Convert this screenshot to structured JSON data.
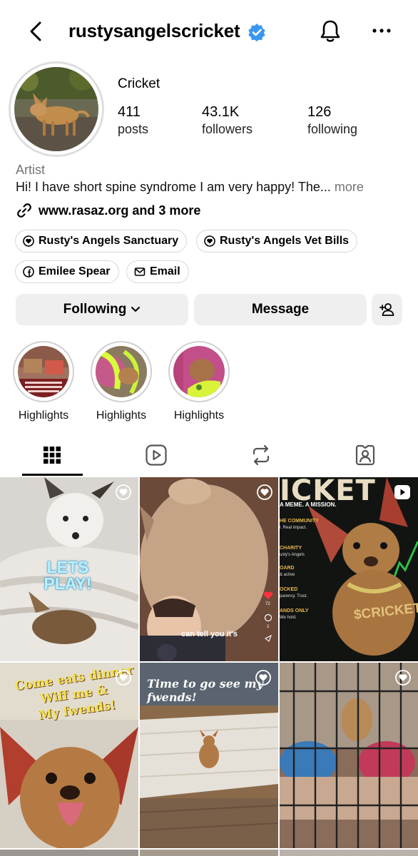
{
  "header": {
    "username": "rustysangelscricket",
    "icons": {
      "back": "chevron-left-icon",
      "verified": "verified-badge-icon",
      "bell": "bell-icon",
      "more": "more-horizontal-icon"
    }
  },
  "profile": {
    "display_name": "Cricket",
    "stats": [
      {
        "value": "411",
        "label": "posts"
      },
      {
        "value": "43.1K",
        "label": "followers"
      },
      {
        "value": "126",
        "label": "following"
      }
    ],
    "category": "Artist",
    "bio": "Hi! I have short spine syndrome I am very happy! The...",
    "bio_more": "more",
    "link": "www.rasaz.org and 3 more",
    "chips": [
      {
        "label": "Rusty's Angels Sanctuary",
        "icon": "fundraiser-icon"
      },
      {
        "label": "Rusty's Angels Vet Bills",
        "icon": "fundraiser-icon"
      },
      {
        "label": "Emilee Spear",
        "icon": "facebook-icon"
      },
      {
        "label": "Email",
        "icon": "mail-icon"
      }
    ]
  },
  "actions": {
    "following": "Following",
    "message": "Message",
    "add_person_icon": "add-person-icon"
  },
  "highlights": [
    {
      "label": "Highlights"
    },
    {
      "label": "Highlights"
    },
    {
      "label": "Highlights"
    }
  ],
  "tabs": [
    {
      "icon": "grid-icon",
      "active": true
    },
    {
      "icon": "reels-icon",
      "active": false
    },
    {
      "icon": "reposts-icon",
      "active": false
    },
    {
      "icon": "tagged-icon",
      "active": false
    }
  ],
  "posts": {
    "p1_text": "LETS PLAY!",
    "p2_caption": "can tell you it's",
    "p2_like_count": "72",
    "p2_comment_count": "2",
    "p3_title": "ICKET",
    "p3_sub": "A MEME. A MISSION.",
    "p3_lines": [
      "HE COMMUNITY",
      "l. Real impact.",
      "CHARITY",
      "usty's Angels",
      "OARD",
      "& active",
      "OCKED",
      "parency. Trust.",
      "ANDS ONLY",
      "We hold."
    ],
    "p3_brand": "$CRICKET",
    "p4_text": "Come eats dinner Wiff me & My fwends!",
    "p4_lines": [
      "Come eats dinner",
      "Wiff me &",
      "My fwends!"
    ],
    "p5_text": "Time to go see my fwends!"
  }
}
